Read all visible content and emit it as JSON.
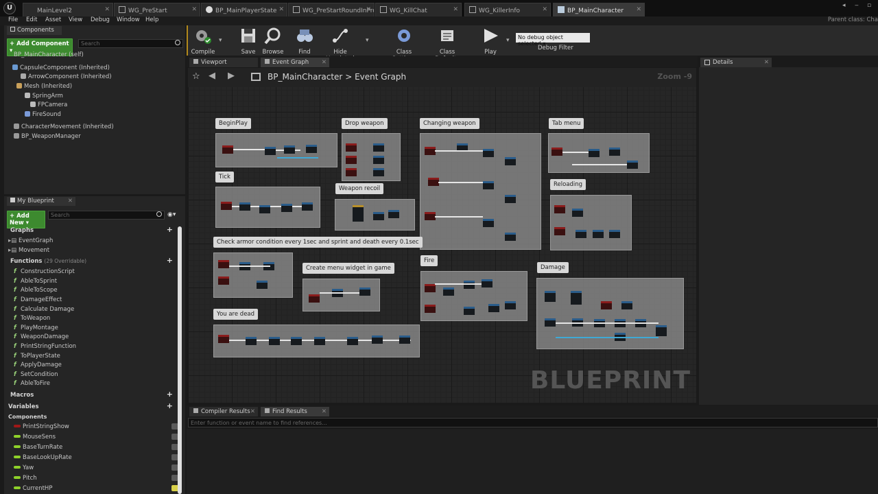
{
  "tabs": [
    {
      "label": "MainLevel2",
      "icon": "level-icon"
    },
    {
      "label": "WG_PreStart",
      "icon": "widget-icon"
    },
    {
      "label": "BP_MainPlayerState",
      "icon": "blueprint-icon"
    },
    {
      "label": "WG_PreStartRoundInProg",
      "icon": "widget-icon"
    },
    {
      "label": "WG_KillChat",
      "icon": "widget-icon"
    },
    {
      "label": "WG_KillerInfo",
      "icon": "widget-icon"
    },
    {
      "label": "BP_MainCharacter",
      "icon": "blueprint-icon"
    }
  ],
  "menu": [
    "File",
    "Edit",
    "Asset",
    "View",
    "Debug",
    "Window",
    "Help"
  ],
  "parent_class": "Parent class: Cha",
  "components_panel": {
    "title": "Components",
    "add_label": "+ Add Component ▾",
    "search_placeholder": "Search",
    "self_label": "BP_MainCharacter (self)",
    "items": [
      "CapsuleComponent (Inherited)",
      "ArrowComponent (Inherited)",
      "Mesh (Inherited)",
      "SpringArm",
      "FPCamera",
      "FireSound",
      "CharacterMovement (Inherited)",
      "BP_WeaponManager"
    ]
  },
  "my_blueprint": {
    "title": "My Blueprint",
    "add_label": "+ Add New ▾",
    "search_placeholder": "Search",
    "graphs_label": "Graphs",
    "graphs": [
      "EventGraph",
      "Movement"
    ],
    "functions_label": "Functions",
    "functions_count": "(29 Overridable)",
    "functions": [
      "ConstructionScript",
      "AbleToSprint",
      "AbleToScope",
      "DamageEffect",
      "Calculate Damage",
      "ToWeapon",
      "PlayMontage",
      "WeaponDamage",
      "PrintStringFunction",
      "ToPlayerState",
      "ApplyDamage",
      "SetCondition",
      "AbleToFire"
    ],
    "macros_label": "Macros",
    "variables_label": "Variables",
    "components_label": "Components",
    "variables": [
      {
        "name": "PrintStringShow",
        "color": "#a01818"
      },
      {
        "name": "MouseSens",
        "color": "#8fd12a"
      },
      {
        "name": "BaseTurnRate",
        "color": "#8fd12a"
      },
      {
        "name": "BaseLookUpRate",
        "color": "#8fd12a"
      },
      {
        "name": "Yaw",
        "color": "#8fd12a"
      },
      {
        "name": "Pitch",
        "color": "#8fd12a"
      },
      {
        "name": "CurrentHP",
        "color": "#8fd12a"
      }
    ]
  },
  "toolbar": {
    "compile": "Compile",
    "save": "Save",
    "browse": "Browse",
    "find": "Find",
    "hide_unrelated": "Hide Unrelated",
    "class_settings": "Class Settings",
    "class_defaults": "Class Defaults",
    "play": "Play",
    "debug_select": "No debug object selected ▾",
    "debug_filter": "Debug Filter"
  },
  "graph_tabs": [
    "Viewport",
    "Event Graph"
  ],
  "breadcrumb": {
    "root": "BP_MainCharacter",
    "sep": ">",
    "leaf": "Event Graph"
  },
  "zoom": "Zoom -9",
  "watermark": "BLUEPRINT",
  "comments": [
    "BeginPlay",
    "Drop weapon",
    "Changing weapon",
    "Tab menu",
    "Tick",
    "Weapon recoil",
    "Reloading",
    "Check armor condition every 1sec and sprint and death every 0.1sec",
    "Create menu widget in game",
    "Fire",
    "Damage",
    "You are dead"
  ],
  "details_title": "Details",
  "bottom_tabs": [
    "Compiler Results",
    "Find Results"
  ],
  "find_placeholder": "Enter function or event name to find references..."
}
